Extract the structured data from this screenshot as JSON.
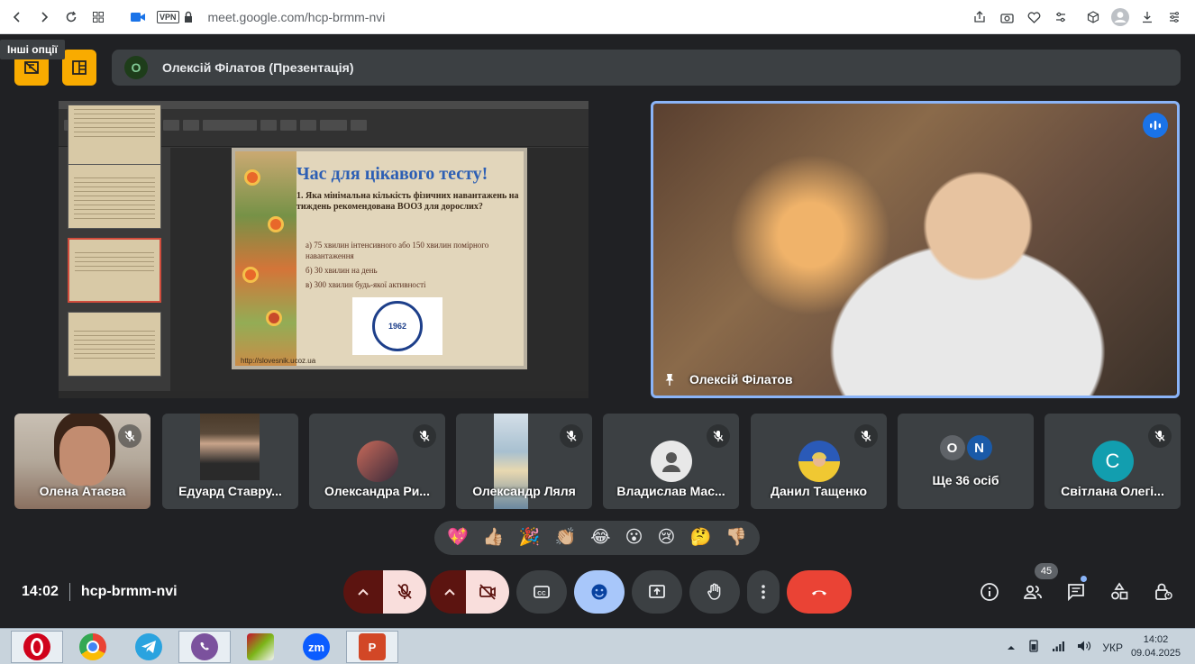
{
  "browser": {
    "url": "meet.google.com/hcp-brmm-nvi",
    "vpn_label": "VPN",
    "icons": [
      "back-icon",
      "forward-icon",
      "reload-icon",
      "tabs-grid-icon",
      "meet-camera-icon",
      "lock-icon",
      "share-icon",
      "camera-icon",
      "heart-icon",
      "settings-icon",
      "cube-icon",
      "profile-icon",
      "download-icon",
      "menu-icon"
    ]
  },
  "tooltip": "Інші опції",
  "presentation_bar": {
    "avatar_letter": "О",
    "presenter": "Олексій Філатов (Презентація)"
  },
  "slide": {
    "title": "Час для цікавого тесту!",
    "question": "1. Яка мінімальна кількість фізичних навантажень на тиждень рекомендована ВООЗ для дорослих?",
    "answers": [
      "а) 75 хвилин інтенсивного або 150 хвилин помірного навантаження",
      "б) 30 хвилин на день",
      "в) 300 хвилин будь-якої активності"
    ],
    "url": "http://slovesnik.ucoz.ua",
    "logo_year": "1962"
  },
  "main_video": {
    "name": "Олексій Філатов"
  },
  "participants": [
    {
      "name": "Олена Атаєва"
    },
    {
      "name": "Едуард Ставру..."
    },
    {
      "name": "Олександра Ри..."
    },
    {
      "name": "Олександр Ляля"
    },
    {
      "name": "Владислав Мас..."
    },
    {
      "name": "Данил Тащенко"
    },
    {
      "name": "Ще 36 осіб",
      "avatars": [
        "О",
        "N"
      ]
    },
    {
      "name": "Світлана Олегі...",
      "avatar_letter": "С"
    }
  ],
  "reactions": [
    "💖",
    "👍🏼",
    "🎉",
    "👏🏼",
    "😂",
    "😮",
    "😢",
    "🤔",
    "👎🏼"
  ],
  "controls": {
    "time": "14:02",
    "room": "hcp-brmm-nvi",
    "participants_count": "45"
  },
  "taskbar": {
    "lang": "УКР",
    "time": "14:02",
    "date": "09.04.2025",
    "apps": [
      "Opera",
      "Chrome",
      "Telegram",
      "Viber",
      "WinRAR",
      "Zoom",
      "PowerPoint"
    ],
    "zoom_label": "zm",
    "ppt_label": "P"
  },
  "colors": {
    "meet_bg": "#202124",
    "tile_bg": "#3c4043",
    "accent_yellow": "#f9ab00",
    "speaking_blue": "#1a73e8",
    "end_call_red": "#ea4335",
    "muted_red": "#5c1410"
  }
}
